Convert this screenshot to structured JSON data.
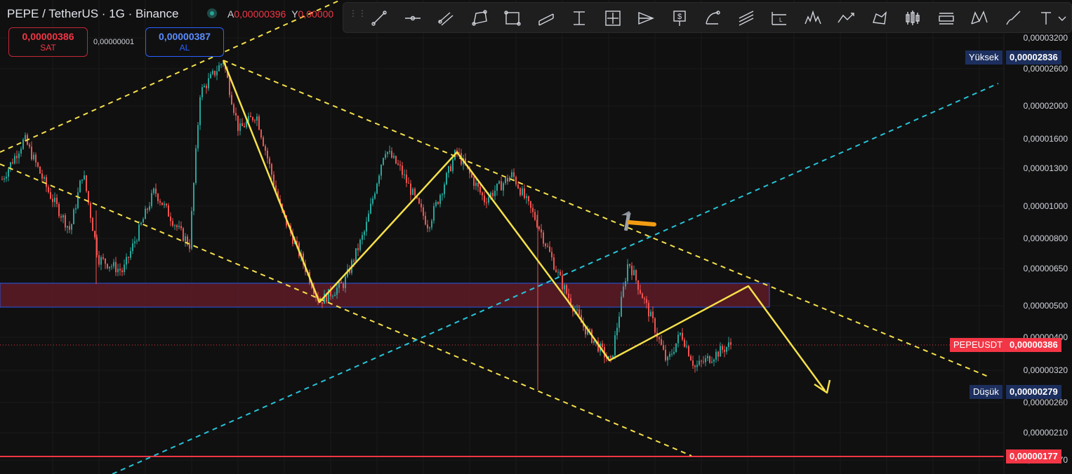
{
  "header": {
    "symbol_title": "PEPE / TetherUS · 1G · Binance",
    "ohlc": [
      {
        "key": "A",
        "value": "0,00000396"
      },
      {
        "key": "Y",
        "value": "0,00000"
      }
    ]
  },
  "trade": {
    "sell_price": "0,00000386",
    "sell_label": "SAT",
    "spread": "0,00000001",
    "buy_price": "0,00000387",
    "buy_label": "AL"
  },
  "toolbar": {
    "tools": [
      "trend-line-icon",
      "horizontal-ray-icon",
      "parallel-channel-icon",
      "polygon-icon",
      "rectangle-icon",
      "channel-icon",
      "vertical-range-icon",
      "date-price-range-icon",
      "pitchfork-icon",
      "price-note-icon",
      "arc-icon",
      "multi-line-icon",
      "long-position-icon",
      "head-shoulders-icon",
      "path-icon",
      "pattern-icon",
      "candles-icon",
      "price-label-icon",
      "xabcd-icon",
      "brush-icon",
      "text-icon"
    ]
  },
  "price_axis": {
    "labels": [
      "0,00003200",
      "0,00002600",
      "0,00002000",
      "0,00001600",
      "0,00001300",
      "0,00001000",
      "0,00000800",
      "0,00000650",
      "0,00000500",
      "0,00000400",
      "0,00000320",
      "0,00000260",
      "0,00000210",
      "0,00000170"
    ],
    "high_label": "Yüksek",
    "high_value": "0,00002836",
    "symbol_label": "PEPEUSDT",
    "last_value": "0,00000386",
    "low_label": "Düşük",
    "low_value": "0,00000279",
    "support_value": "0,00000177"
  },
  "colors": {
    "background": "#101010",
    "up": "#26a69a",
    "down": "#ef5350",
    "yellow": "#f5e04a",
    "cyan": "#27c3d8",
    "red_line": "#f23645",
    "zone_fill": "#5a1b26",
    "zone_border": "#2962ff",
    "axis_tag_blue": "#1c2f5e"
  },
  "chart_data": {
    "type": "candlestick",
    "log_scale": true,
    "last_price": 3.86e-06,
    "session_high": 2.836e-05,
    "session_low": 2.79e-06,
    "horizontal_levels": [
      1.77e-06
    ],
    "zone": {
      "from": 5e-06,
      "to": 5.9e-06
    },
    "zigzag_prices": [
      2.75e-05,
      5e-06,
      1.47e-05,
      3.3e-06,
      5.8e-06
    ]
  }
}
